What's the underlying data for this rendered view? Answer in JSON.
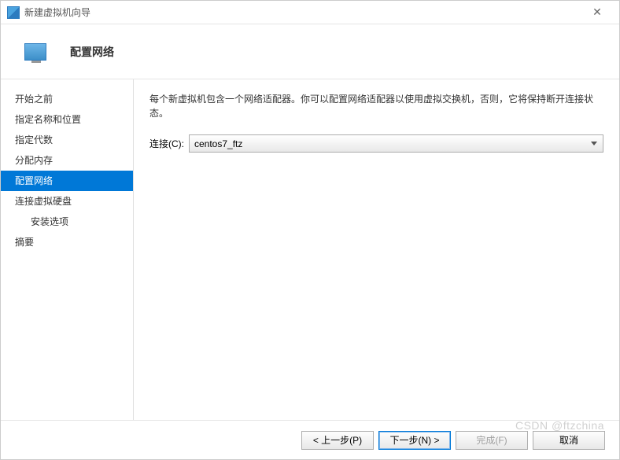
{
  "window": {
    "title": "新建虚拟机向导"
  },
  "header": {
    "title": "配置网络"
  },
  "sidebar": {
    "items": [
      {
        "label": "开始之前",
        "indent": false,
        "selected": false
      },
      {
        "label": "指定名称和位置",
        "indent": false,
        "selected": false
      },
      {
        "label": "指定代数",
        "indent": false,
        "selected": false
      },
      {
        "label": "分配内存",
        "indent": false,
        "selected": false
      },
      {
        "label": "配置网络",
        "indent": false,
        "selected": true
      },
      {
        "label": "连接虚拟硬盘",
        "indent": false,
        "selected": false
      },
      {
        "label": "安装选项",
        "indent": true,
        "selected": false
      },
      {
        "label": "摘要",
        "indent": false,
        "selected": false
      }
    ]
  },
  "main": {
    "description": "每个新虚拟机包含一个网络适配器。你可以配置网络适配器以使用虚拟交换机，否则，它将保持断开连接状态。",
    "connection_label": "连接(C):",
    "connection_value": "centos7_ftz"
  },
  "footer": {
    "back": "< 上一步(P)",
    "next": "下一步(N) >",
    "finish": "完成(F)",
    "cancel": "取消"
  },
  "watermark": "CSDN @ftzchina"
}
